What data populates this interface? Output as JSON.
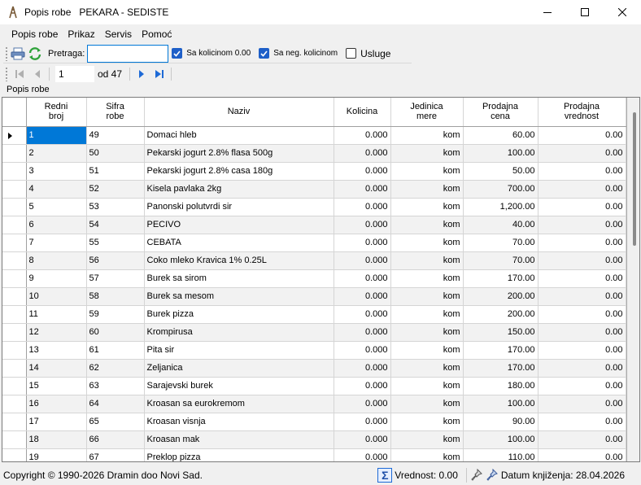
{
  "window": {
    "title_prefix": "Popis robe",
    "title_suffix": "PEKARA - SEDISTE",
    "minimize": "—",
    "maximize": "☐",
    "close": "✕"
  },
  "menu": [
    "Popis robe",
    "Prikaz",
    "Servis",
    "Pomoć"
  ],
  "toolbar": {
    "print_icon": "printer-icon",
    "refresh_icon": "refresh-icon",
    "search_label": "Pretraga:",
    "search_value": "",
    "chk_qty_label": "Sa kolicinom 0.00",
    "chk_qty_checked": true,
    "chk_neg_label": "Sa neg. kolicinom",
    "chk_neg_checked": true,
    "chk_services_label": "Usluge",
    "chk_services_checked": false
  },
  "navigator": {
    "position": "1",
    "of_text": "od 47"
  },
  "group_caption": "Popis robe",
  "grid": {
    "columns": [
      {
        "key": "rb",
        "label": "Redni\nbroj"
      },
      {
        "key": "sifra",
        "label": "Sifra\nrobe"
      },
      {
        "key": "naziv",
        "label": "Naziv"
      },
      {
        "key": "kolicina",
        "label": "Kolicina"
      },
      {
        "key": "jm",
        "label": "Jedinica\nmere"
      },
      {
        "key": "cena",
        "label": "Prodajna\ncena"
      },
      {
        "key": "vrednost",
        "label": "Prodajna\nvrednost"
      }
    ],
    "rows": [
      [
        "1",
        "49",
        "Domaci hleb",
        "0.000",
        "kom",
        "60.00",
        "0.00"
      ],
      [
        "2",
        "50",
        "Pekarski jogurt 2.8% flasa 500g",
        "0.000",
        "kom",
        "100.00",
        "0.00"
      ],
      [
        "3",
        "51",
        "Pekarski jogurt 2.8% casa 180g",
        "0.000",
        "kom",
        "50.00",
        "0.00"
      ],
      [
        "4",
        "52",
        "Kisela pavlaka 2kg",
        "0.000",
        "kom",
        "700.00",
        "0.00"
      ],
      [
        "5",
        "53",
        "Panonski polutvrdi sir",
        "0.000",
        "kom",
        "1,200.00",
        "0.00"
      ],
      [
        "6",
        "54",
        "PECIVO",
        "0.000",
        "kom",
        "40.00",
        "0.00"
      ],
      [
        "7",
        "55",
        "CEBATA",
        "0.000",
        "kom",
        "70.00",
        "0.00"
      ],
      [
        "8",
        "56",
        "Coko mleko Kravica 1% 0.25L",
        "0.000",
        "kom",
        "70.00",
        "0.00"
      ],
      [
        "9",
        "57",
        "Burek sa sirom",
        "0.000",
        "kom",
        "170.00",
        "0.00"
      ],
      [
        "10",
        "58",
        "Burek sa mesom",
        "0.000",
        "kom",
        "200.00",
        "0.00"
      ],
      [
        "11",
        "59",
        "Burek pizza",
        "0.000",
        "kom",
        "200.00",
        "0.00"
      ],
      [
        "12",
        "60",
        "Krompirusa",
        "0.000",
        "kom",
        "150.00",
        "0.00"
      ],
      [
        "13",
        "61",
        "Pita sir",
        "0.000",
        "kom",
        "170.00",
        "0.00"
      ],
      [
        "14",
        "62",
        "Zeljanica",
        "0.000",
        "kom",
        "170.00",
        "0.00"
      ],
      [
        "15",
        "63",
        "Sarajevski burek",
        "0.000",
        "kom",
        "180.00",
        "0.00"
      ],
      [
        "16",
        "64",
        "Kroasan sa eurokremom",
        "0.000",
        "kom",
        "100.00",
        "0.00"
      ],
      [
        "17",
        "65",
        "Kroasan visnja",
        "0.000",
        "kom",
        "90.00",
        "0.00"
      ],
      [
        "18",
        "66",
        "Kroasan mak",
        "0.000",
        "kom",
        "100.00",
        "0.00"
      ],
      [
        "19",
        "67",
        "Preklop pizza",
        "0.000",
        "kom",
        "110.00",
        "0.00"
      ]
    ],
    "selected_row": 0
  },
  "status": {
    "copyright": "Copyright © 1990-2026 Dramin doo Novi Sad.",
    "vrednost": "Vrednost: 0.00",
    "datum": "Datum knjiženja: 28.04.2026"
  },
  "colors": {
    "accent": "#0078d7",
    "checkbox": "#1e5fc8",
    "nav_arrow": "#1e6ad6"
  }
}
